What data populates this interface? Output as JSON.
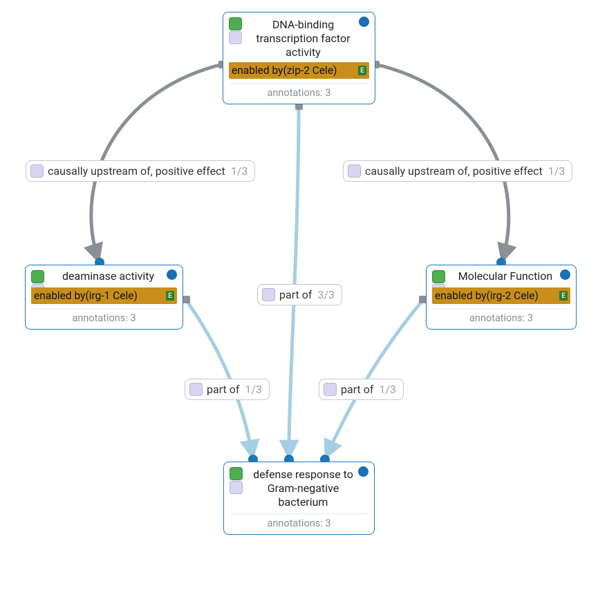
{
  "nodes": {
    "top": {
      "title": "DNA-binding transcription factor activity",
      "enabled_by": "enabled by(zip-2 Cele)",
      "e_badge": "E",
      "annotations": "annotations: 3"
    },
    "left": {
      "title": "deaminase activity",
      "enabled_by": "enabled by(irg-1 Cele)",
      "e_badge": "E",
      "annotations": "annotations: 3"
    },
    "right": {
      "title": "Molecular Function",
      "enabled_by": "enabled by(irg-2 Cele)",
      "e_badge": "E",
      "annotations": "annotations: 3"
    },
    "bottom": {
      "title": "defense response to Gram-negative bacterium",
      "annotations": "annotations: 3"
    }
  },
  "edge_labels": {
    "upstream_left": {
      "text": "causally upstream of, positive effect",
      "count": "1/3"
    },
    "upstream_right": {
      "text": "causally upstream of, positive effect",
      "count": "1/3"
    },
    "part_center": {
      "text": "part of",
      "count": "3/3"
    },
    "part_left": {
      "text": "part of",
      "count": "1/3"
    },
    "part_right": {
      "text": "part of",
      "count": "1/3"
    }
  },
  "colors": {
    "node_border": "#1d79c4",
    "accent_dot": "#1770b8",
    "edge_gray": "#8a8f96",
    "edge_blue": "#a6cee3",
    "enabled_bg": "#c98f1a",
    "badge_green": "#4fae54",
    "badge_lavender": "#d8d6f0"
  }
}
